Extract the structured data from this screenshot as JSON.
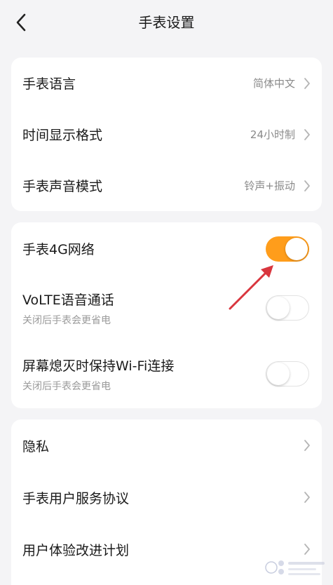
{
  "header": {
    "title": "手表设置",
    "back_icon": "chevron-left-icon"
  },
  "section1": {
    "items": [
      {
        "label": "手表语言",
        "value": "简体中文"
      },
      {
        "label": "时间显示格式",
        "value": "24小时制"
      },
      {
        "label": "手表声音模式",
        "value": "铃声+振动"
      }
    ]
  },
  "section2": {
    "items": [
      {
        "label": "手表4G网络",
        "toggle": true
      },
      {
        "label": "VoLTE语音通话",
        "sub": "关闭后手表会更省电",
        "toggle": false
      },
      {
        "label": "屏幕熄灭时保持Wi-Fi连接",
        "sub": "关闭后手表会更省电",
        "toggle": false
      }
    ]
  },
  "section3": {
    "items": [
      {
        "label": "隐私"
      },
      {
        "label": "手表用户服务协议"
      },
      {
        "label": "用户体验改进计划"
      }
    ]
  },
  "colors": {
    "background": "#f4f4f6",
    "card": "#ffffff",
    "toggle_on": "#ff9d1b",
    "annotation_arrow": "#d9363e"
  }
}
